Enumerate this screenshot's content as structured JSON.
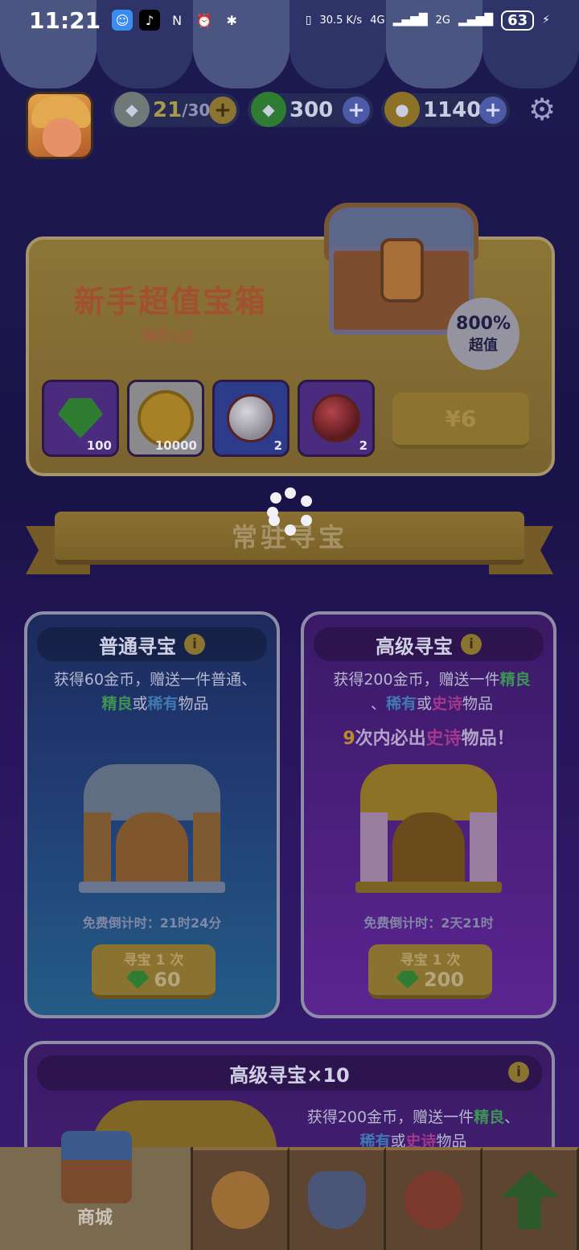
{
  "status_bar": {
    "time": "11:21",
    "net_speed_top": "30.5",
    "net_speed_unit": "K/s",
    "net_4g": "4G",
    "net_2g": "2G",
    "battery": "63"
  },
  "resources": {
    "energy": {
      "value": "21",
      "max": "/30"
    },
    "gems": {
      "value": "300"
    },
    "coins": {
      "value": "1140"
    },
    "plus": "+"
  },
  "starter_pack": {
    "title": "新手超值宝箱",
    "limit": "限购1次",
    "badge_percent": "800%",
    "badge_text": "超值",
    "items": [
      {
        "icon": "gem-icon",
        "count": "100"
      },
      {
        "icon": "coin-icon",
        "count": "10000"
      },
      {
        "icon": "ball-icon",
        "count": "2"
      },
      {
        "icon": "ball-red-icon",
        "count": "2"
      }
    ],
    "price": "¥6"
  },
  "section": {
    "title": "常驻寻宝"
  },
  "normal_hunt": {
    "title": "普通寻宝",
    "desc_prefix": "获得60金币，赠送一件普通、",
    "desc_green": "精良",
    "desc_or": "或",
    "desc_blue": "稀有",
    "desc_suffix": "物品",
    "countdown": "免费倒计时：21时24分",
    "button_label": "寻宝 1 次",
    "button_cost": "60"
  },
  "advanced_hunt": {
    "title": "高级寻宝",
    "desc_prefix": "获得200金币，赠送一件",
    "desc_green": "精良",
    "desc_sep": "、",
    "desc_blue": "稀有",
    "desc_or": "或",
    "desc_pink": "史诗",
    "desc_suffix": "物品",
    "guarantee_num": "9",
    "guarantee_mid": "次内必出",
    "guarantee_pink": "史诗",
    "guarantee_end": "物品！",
    "countdown": "免费倒计时：2天21时",
    "button_label": "寻宝 1 次",
    "button_cost": "200"
  },
  "advanced_hunt_x10": {
    "title": "高级寻宝×10",
    "desc_prefix": "获得200金币，赠送一件",
    "desc_green": "精良",
    "desc_sep": "、",
    "desc_blue": "稀有",
    "desc_or": "或",
    "desc_pink": "史诗",
    "desc_suffix": "物品"
  },
  "nav": {
    "shop_label": "商城"
  },
  "colors": {
    "accent_gold": "#8a7230",
    "green_highlight": "#3c9455",
    "blue_highlight": "#3e79b0",
    "pink_highlight": "#a1388c"
  }
}
